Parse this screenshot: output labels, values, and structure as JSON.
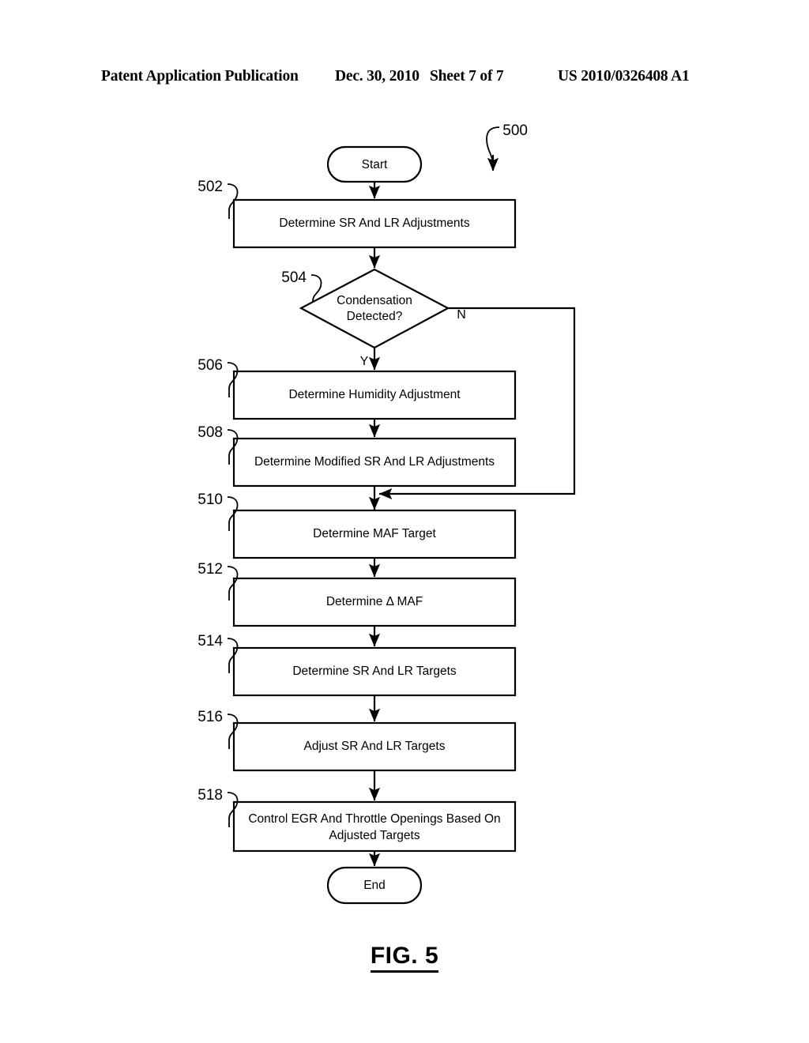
{
  "header": {
    "publication": "Patent Application Publication",
    "date": "Dec. 30, 2010",
    "sheet": "Sheet 7 of 7",
    "patent_number": "US 2010/0326408 A1"
  },
  "figure": {
    "caption": "FIG. 5",
    "diagram_reference": "500",
    "terminals": {
      "start": "Start",
      "end": "End"
    },
    "branch_labels": {
      "yes": "Y",
      "no": "N"
    },
    "steps": [
      {
        "ref": "502",
        "text": "Determine SR And LR Adjustments",
        "shape": "process"
      },
      {
        "ref": "504",
        "text": "Condensation Detected?",
        "text_line1": "Condensation",
        "text_line2": "Detected?",
        "shape": "decision"
      },
      {
        "ref": "506",
        "text": "Determine Humidity Adjustment",
        "shape": "process"
      },
      {
        "ref": "508",
        "text": "Determine Modified SR And LR Adjustments",
        "shape": "process"
      },
      {
        "ref": "510",
        "text": "Determine MAF Target",
        "shape": "process"
      },
      {
        "ref": "512",
        "text": "Determine Δ MAF",
        "shape": "process"
      },
      {
        "ref": "514",
        "text": "Determine SR And LR Targets",
        "shape": "process"
      },
      {
        "ref": "516",
        "text": "Adjust SR And LR Targets",
        "shape": "process"
      },
      {
        "ref": "518",
        "text": "Control EGR And Throttle Openings Based On Adjusted Targets",
        "text_line1": "Control EGR And Throttle Openings Based On",
        "text_line2": "Adjusted Targets",
        "shape": "process"
      }
    ]
  },
  "colors": {
    "ink": "#000000",
    "paper": "#ffffff"
  }
}
